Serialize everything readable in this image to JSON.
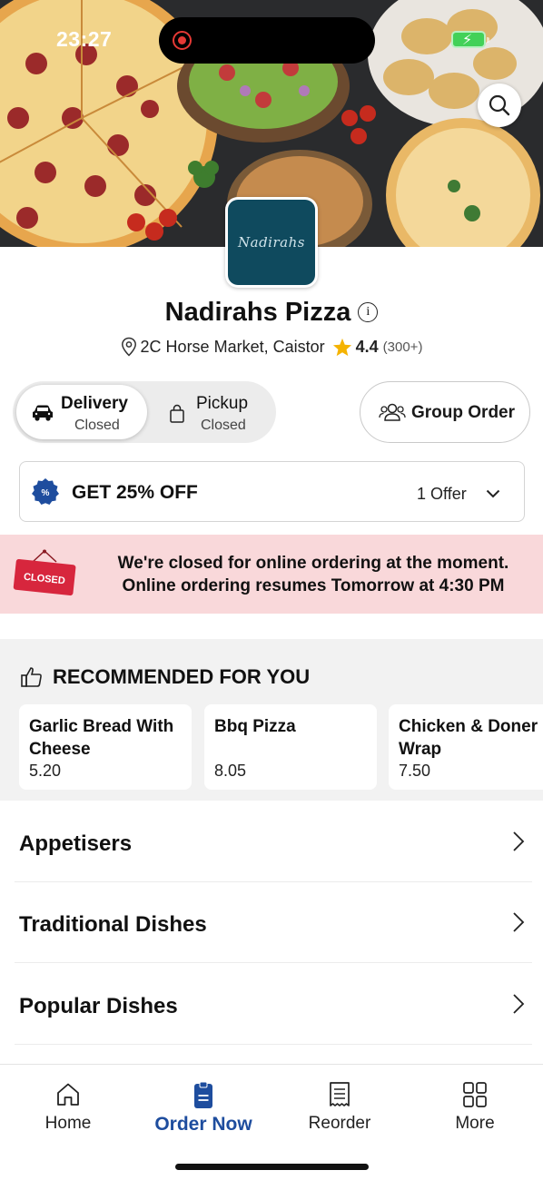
{
  "status_bar": {
    "time": "23:27"
  },
  "restaurant": {
    "name": "Nadirahs Pizza",
    "logo_text": "Nadirahs",
    "address": "2C Horse Market, Caistor",
    "rating": "4.4",
    "rating_count": "(300+)"
  },
  "modes": {
    "delivery": {
      "title": "Delivery",
      "status": "Closed"
    },
    "pickup": {
      "title": "Pickup",
      "status": "Closed"
    }
  },
  "group_order_label": "Group Order",
  "offer": {
    "title": "GET 25% OFF",
    "count": "1 Offer"
  },
  "closed_banner": {
    "sign": "CLOSED",
    "line1": "We're closed for online ordering at the moment.",
    "line2": "Online ordering resumes Tomorrow at 4:30 PM"
  },
  "recommended": {
    "title": "RECOMMENDED FOR YOU",
    "items": [
      {
        "name_line1": "Garlic Bread With",
        "name_line2": "Cheese",
        "price": "5.20"
      },
      {
        "name_line1": "Bbq Pizza",
        "name_line2": "",
        "price": "8.05"
      },
      {
        "name_line1": "Chicken & Doner",
        "name_line2": "Wrap",
        "price": "7.50"
      }
    ]
  },
  "categories": [
    "Appetisers",
    "Traditional Dishes",
    "Popular Dishes"
  ],
  "bottom_nav": [
    {
      "label": "Home",
      "icon": "home-icon"
    },
    {
      "label": "Order Now",
      "icon": "order-icon",
      "active": true
    },
    {
      "label": "Reorder",
      "icon": "receipt-icon"
    },
    {
      "label": "More",
      "icon": "grid-icon"
    }
  ],
  "colors": {
    "accent": "#1e4d9e",
    "logo_bg": "#0f4a5e",
    "closed_banner_bg": "#f9d8da",
    "closed_sign": "#d7263d",
    "star": "#f5b301",
    "offer_badge": "#1e4d9e"
  }
}
